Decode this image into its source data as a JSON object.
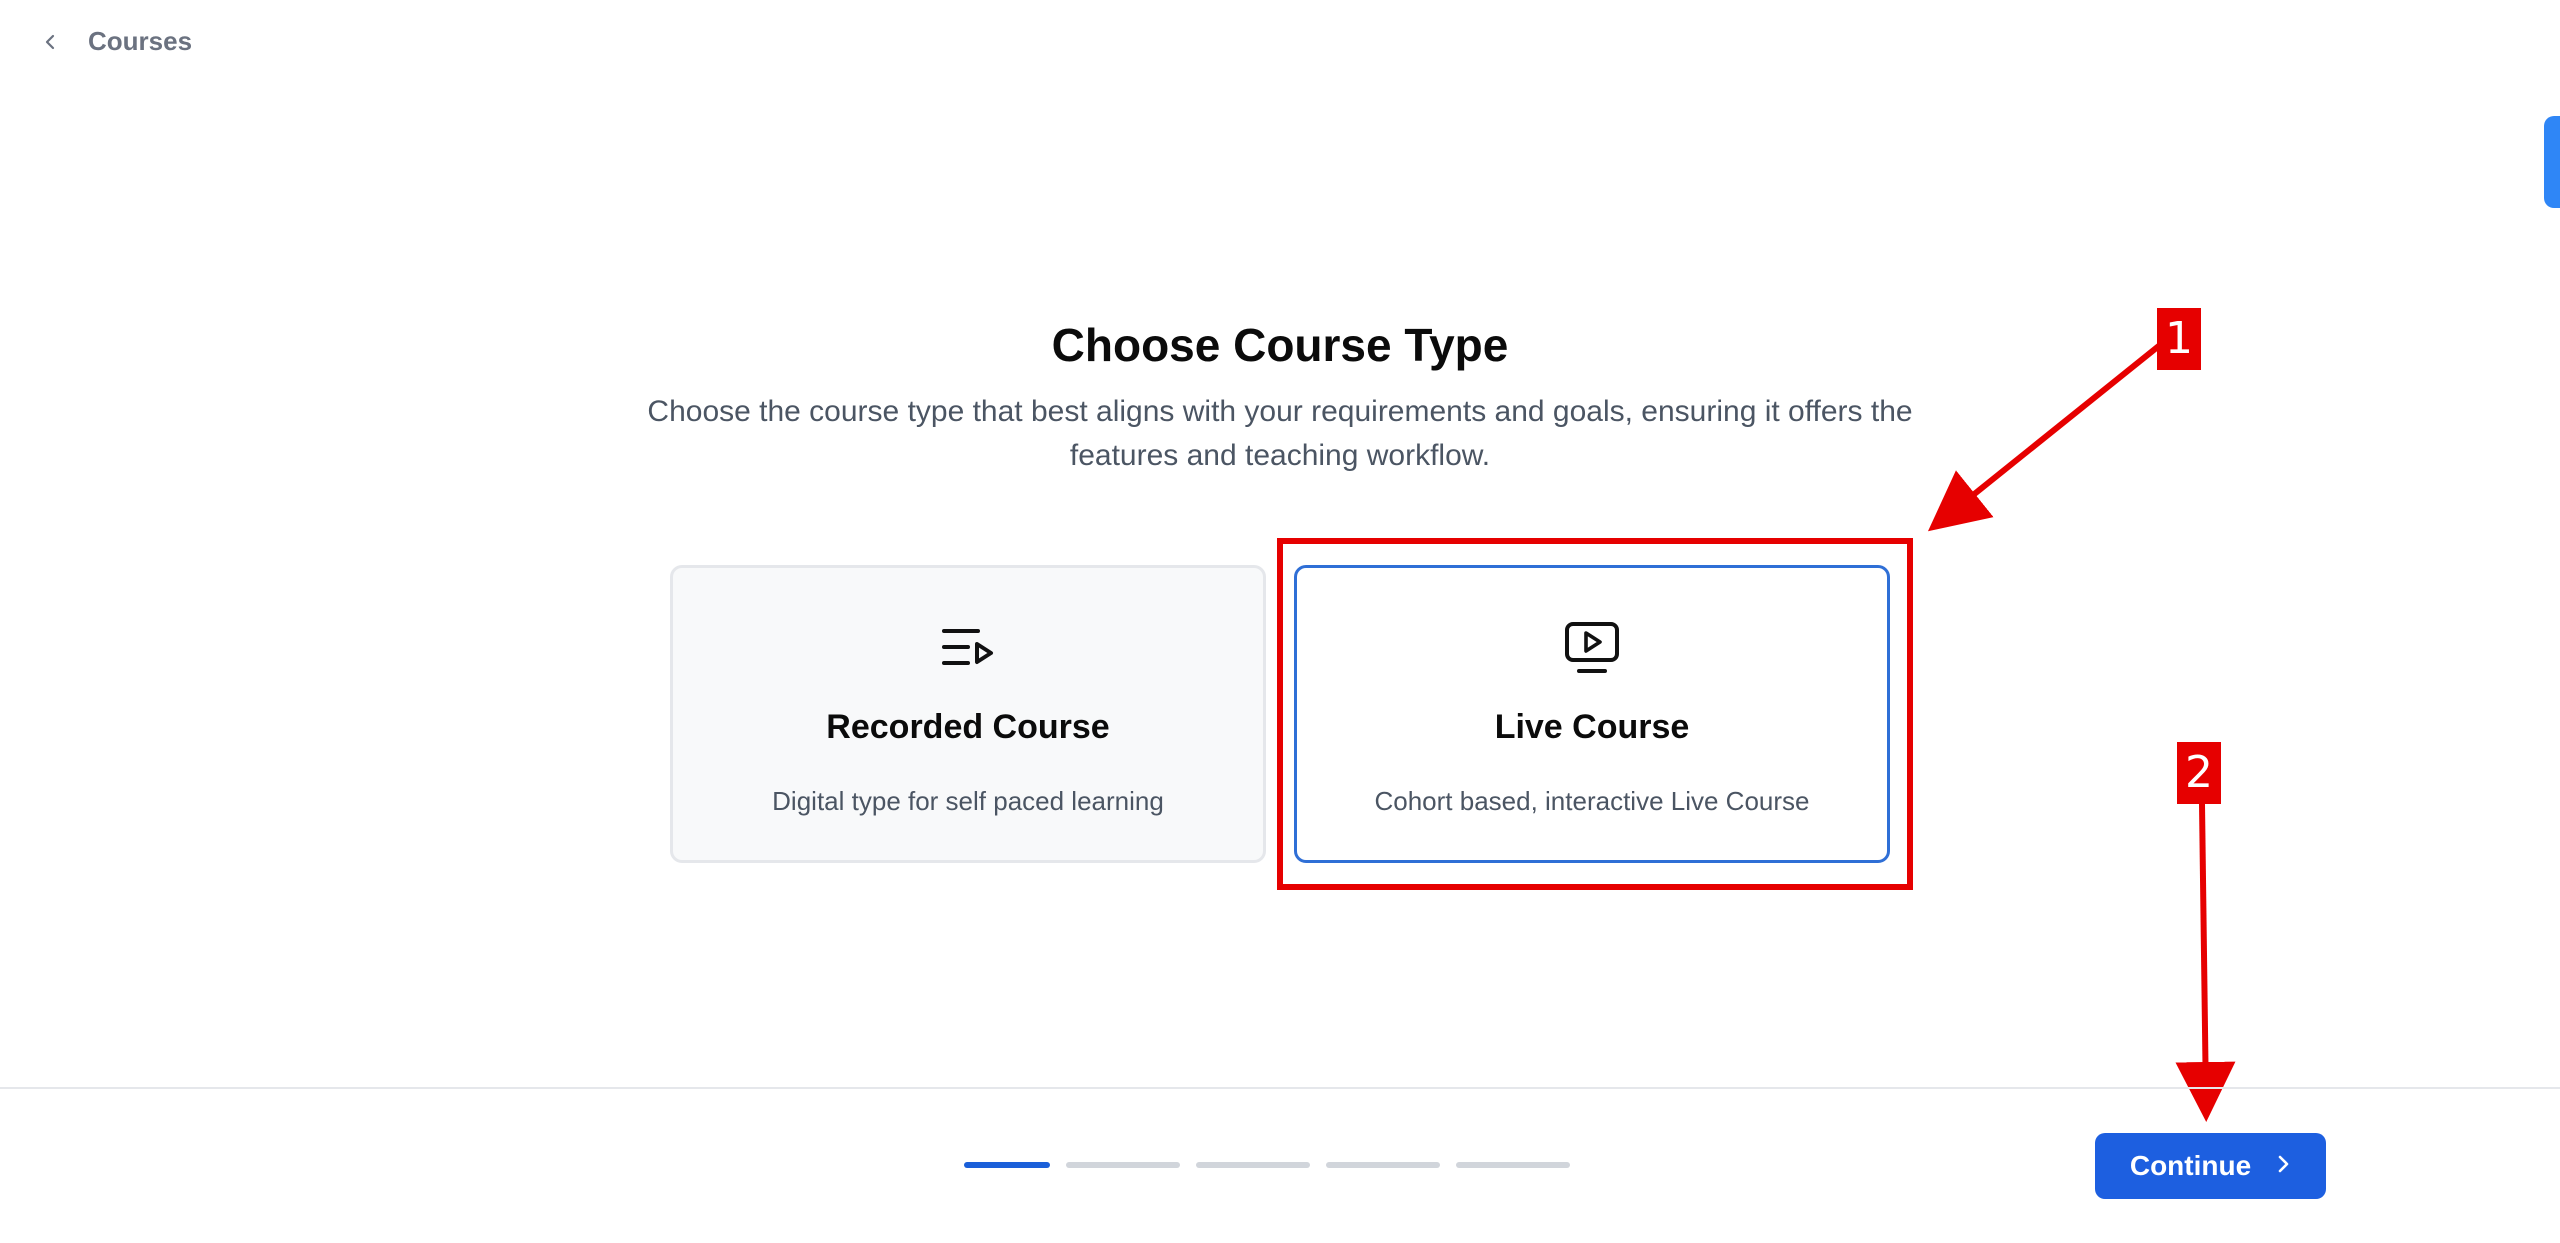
{
  "nav": {
    "back_label": "Courses"
  },
  "main": {
    "title": "Choose Course Type",
    "subtitle": "Choose the course type that best aligns with your requirements and goals, ensuring it offers the features and teaching workflow."
  },
  "cards": [
    {
      "icon": "playlist-icon",
      "title": "Recorded Course",
      "description": "Digital type for self paced learning",
      "selected": false
    },
    {
      "icon": "screen-play-icon",
      "title": "Live Course",
      "description": "Cohort based, interactive Live Course",
      "selected": true
    }
  ],
  "stepper": {
    "total_steps": 5,
    "current_step": 1
  },
  "footer": {
    "continue_label": "Continue"
  },
  "annotations": [
    {
      "label": "1"
    },
    {
      "label": "2"
    }
  ],
  "colors": {
    "accent": "#1d5fe0",
    "selected_border": "#2f6fd6",
    "annotation": "#e60000"
  }
}
